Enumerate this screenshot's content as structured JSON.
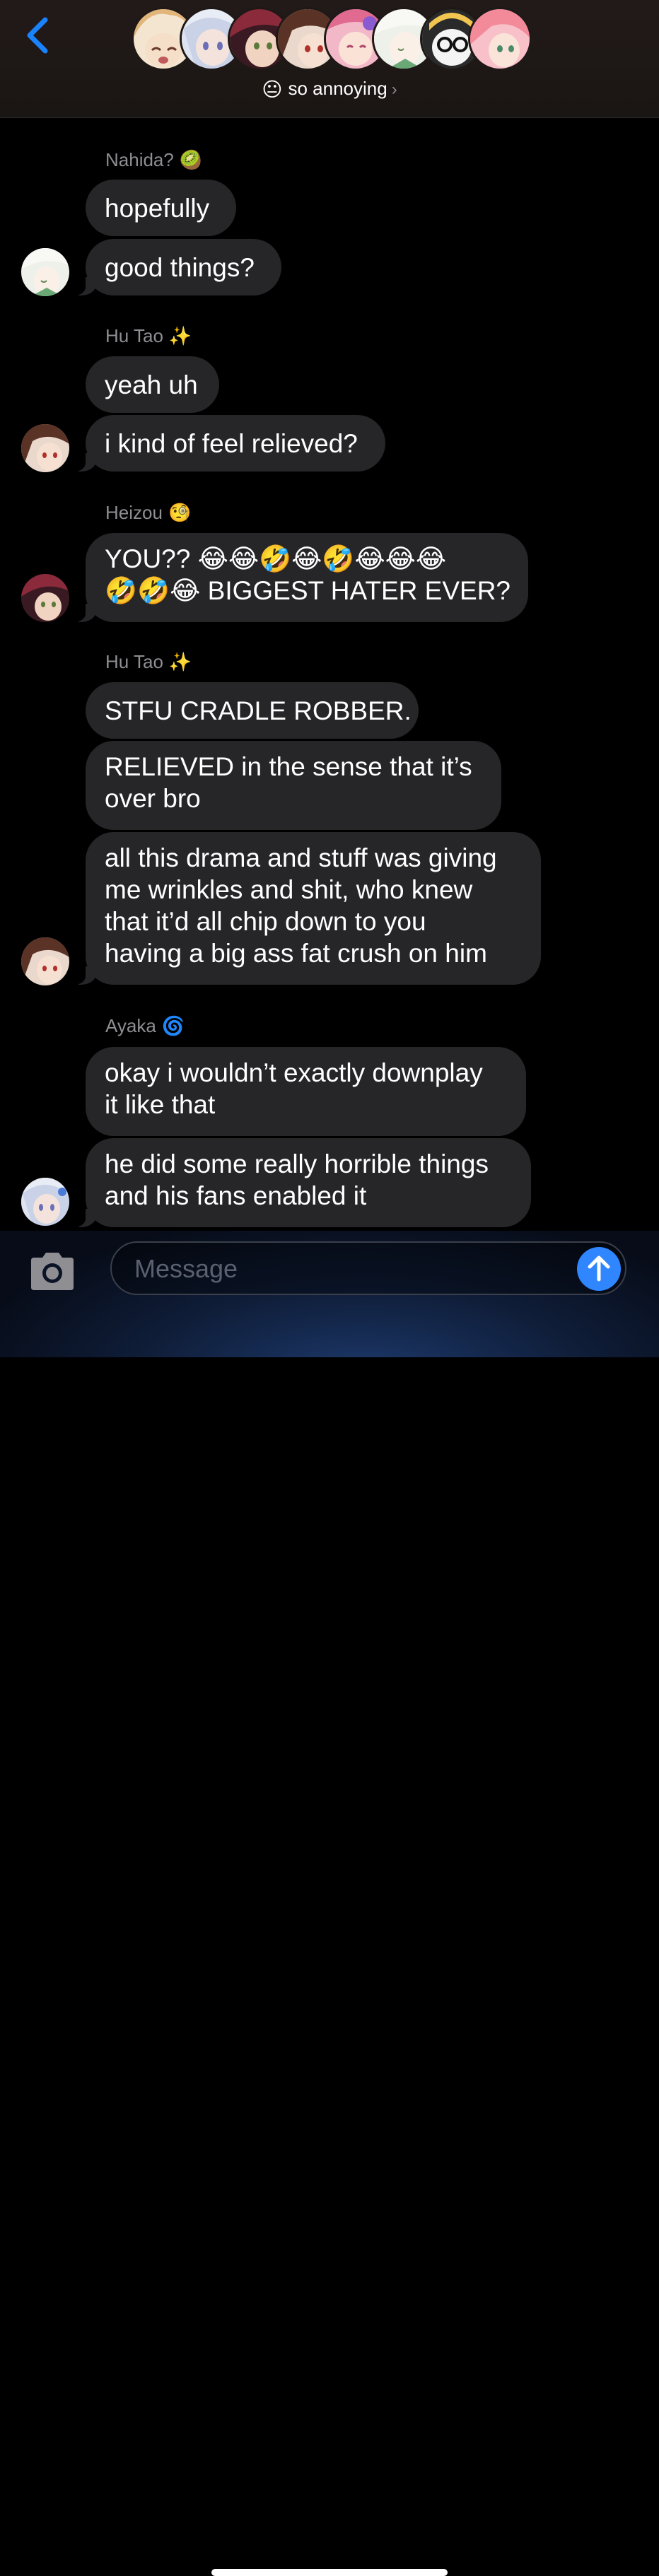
{
  "header": {
    "group_emoji": "😐",
    "group_name": "so annoying",
    "chevron": "›",
    "avatars": [
      {
        "name": "avatar-1",
        "color": "#e7c08e",
        "accent": "#7a4a2a"
      },
      {
        "name": "avatar-2",
        "color": "#d7dbea",
        "accent": "#5a6fb0"
      },
      {
        "name": "avatar-3",
        "color": "#7a2a3a",
        "accent": "#e9c9b0"
      },
      {
        "name": "avatar-4",
        "color": "#5a3326",
        "accent": "#f0d6c4"
      },
      {
        "name": "avatar-5",
        "color": "#e48aa8",
        "accent": "#f6d8c6"
      },
      {
        "name": "avatar-6",
        "color": "#eef0ea",
        "accent": "#6aa876"
      },
      {
        "name": "avatar-7",
        "color": "#f2c550",
        "accent": "#ffffff"
      },
      {
        "name": "avatar-8",
        "color": "#f28a9a",
        "accent": "#f8e0d4"
      }
    ]
  },
  "messages": {
    "g1": {
      "sender": "Nahida?",
      "tag": "🥝",
      "b1": "hopefully",
      "b2": "good things?"
    },
    "g2": {
      "sender": "Hu Tao",
      "tag": "✨",
      "b1": "yeah uh",
      "b2": "i kind of feel relieved?"
    },
    "g3": {
      "sender": "Heizou",
      "tag": "🧐",
      "b1_line1": "YOU?? 😂😂🤣😂🤣😂😂😂",
      "b1_line2": "🤣🤣😂 BIGGEST HATER EVER?"
    },
    "g4": {
      "sender": "Hu Tao",
      "tag": "✨",
      "b1": "STFU CRADLE ROBBER.",
      "b2_line1": "RELIEVED in the sense that it’s",
      "b2_line2": "over bro",
      "b3_line1": "all this drama and stuff was giving",
      "b3_line2": "me wrinkles and shit, who knew",
      "b3_line3": "that it’d all chip down to you",
      "b3_line4": "having a big ass fat crush on him"
    },
    "g5": {
      "sender": "Ayaka",
      "tag": "🌀",
      "b1_line1": "okay i wouldn’t exactly downplay",
      "b1_line2": "it like that",
      "b2_line1": "he did some really horrible things",
      "b2_line2": "and his fans enabled it"
    }
  },
  "composer": {
    "placeholder": "Message",
    "value": ""
  },
  "colors": {
    "bubble": "#262628",
    "sender_label": "#8e8e93",
    "accent_blue": "#2f86ff",
    "back_blue": "#1a82fb"
  }
}
